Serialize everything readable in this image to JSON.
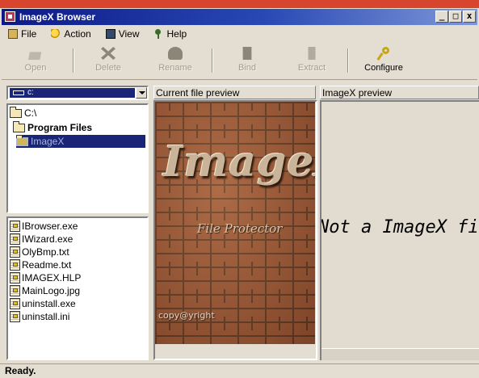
{
  "window": {
    "title": "ImageX Browser"
  },
  "window_buttons": {
    "minimize": "_",
    "maximize": "□",
    "close": "x"
  },
  "menu": [
    {
      "label": "File",
      "icon": "folder-icon"
    },
    {
      "label": "Action",
      "icon": "lightbulb-icon"
    },
    {
      "label": "View",
      "icon": "monitor-icon"
    },
    {
      "label": "Help",
      "icon": "pin-icon"
    }
  ],
  "toolbar": [
    {
      "label": "Open",
      "icon": "open-icon",
      "enabled": false
    },
    {
      "label": "Delete",
      "icon": "delete-icon",
      "enabled": false
    },
    {
      "label": "Rename",
      "icon": "rename-icon",
      "enabled": false
    },
    {
      "label": "Bind",
      "icon": "bind-icon",
      "enabled": false
    },
    {
      "label": "Extract",
      "icon": "extract-icon",
      "enabled": false
    },
    {
      "label": "Configure",
      "icon": "wrench-icon",
      "enabled": true
    }
  ],
  "drive_select": {
    "value": "c:"
  },
  "folder_tree": [
    {
      "label": "C:\\",
      "selected": false
    },
    {
      "label": "Program Files",
      "selected": false
    },
    {
      "label": "ImageX",
      "selected": true
    }
  ],
  "files": [
    "IBrowser.exe",
    "IWizard.exe",
    "OlyBmp.txt",
    "Readme.txt",
    "IMAGEX.HLP",
    "MainLogo.jpg",
    "uninstall.exe",
    "uninstall.ini"
  ],
  "preview": {
    "current_header": "Current file preview",
    "imagex_header": "ImageX preview",
    "logo_text": "ImageX",
    "tagline": "File Protector",
    "credit": "copy@yright",
    "imagex_message": "Not a ImageX file"
  },
  "status": "Ready.",
  "colors": {
    "title_start": "#0c1a86",
    "title_end": "#7f98d8",
    "selection": "#1a2577",
    "face": "#e4ddd2"
  }
}
